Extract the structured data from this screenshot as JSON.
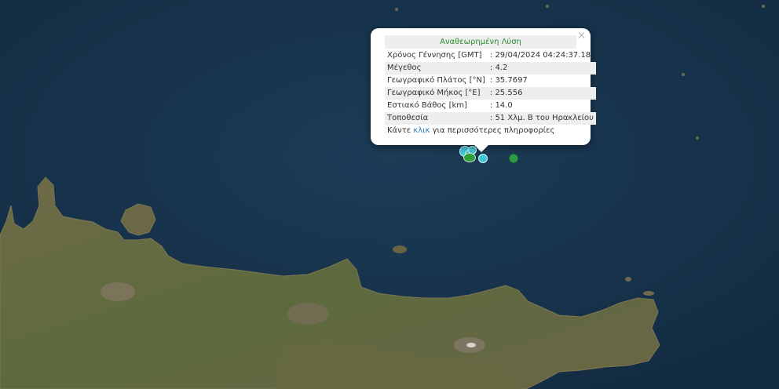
{
  "popup": {
    "title": "Αναθεωρημένη Λύση",
    "close_symbol": "×",
    "rows": [
      {
        "label": "Χρόνος Γέννησης [GMT]",
        "value": ": 29/04/2024 04:24:37.18"
      },
      {
        "label": "Μέγεθος",
        "value": ": 4.2"
      },
      {
        "label": "Γεωγραφικό Πλάτος [°N]",
        "value": ": 35.7697"
      },
      {
        "label": "Γεωγραφικό Μήκος [°E]",
        "value": ": 25.556"
      },
      {
        "label": "Εστιακό Βάθος [km]",
        "value": ": 14.0"
      },
      {
        "label": "Τοποθεσία",
        "value": ": 51 Χλμ. Β του Ηρακλείου"
      }
    ],
    "more_prefix": "Κάντε ",
    "more_link": "κλικ",
    "more_suffix": " για περισσότερες πληροφορίες"
  },
  "markers": {
    "cluster_color": "#3fc6d6",
    "recent_color": "#2e9e3a",
    "other_color": "#2f9a4a"
  }
}
